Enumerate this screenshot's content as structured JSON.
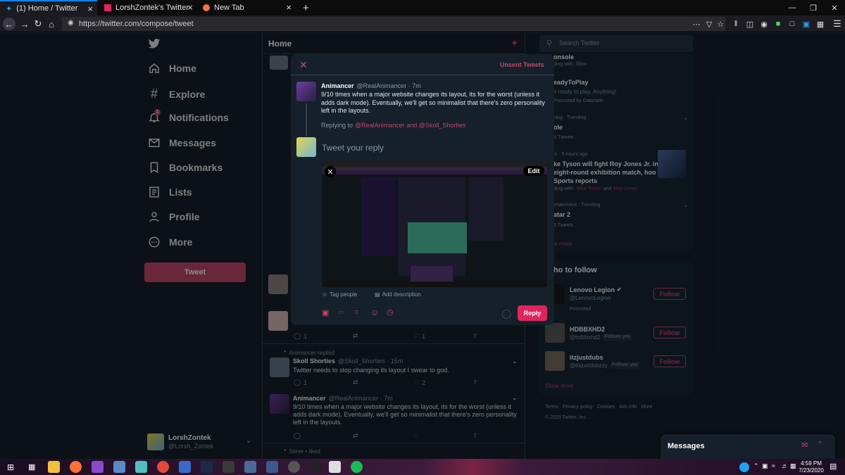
{
  "browser": {
    "tabs": [
      {
        "label": "(1) Home / Twitter"
      },
      {
        "label": "LorshZontek's Twitter Stats Sur"
      },
      {
        "label": "New Tab"
      }
    ],
    "url": "https://twitter.com/compose/tweet"
  },
  "sidebar": {
    "items": [
      {
        "label": "Home",
        "icon": "home-icon"
      },
      {
        "label": "Explore",
        "icon": "hashtag-icon"
      },
      {
        "label": "Notifications",
        "icon": "bell-icon",
        "badge": "1"
      },
      {
        "label": "Messages",
        "icon": "mail-icon"
      },
      {
        "label": "Bookmarks",
        "icon": "bookmark-icon"
      },
      {
        "label": "Lists",
        "icon": "list-icon"
      },
      {
        "label": "Profile",
        "icon": "person-icon"
      },
      {
        "label": "More",
        "icon": "more-icon"
      }
    ],
    "tweet_button": "Tweet",
    "account": {
      "name": "LorshZontek",
      "handle": "@Lorsh_Zontek"
    }
  },
  "timeline": {
    "header": "Home",
    "counts_row1": {
      "reply": "1",
      "like": "1"
    },
    "activity_label": "Animancer replied",
    "tweet1": {
      "name": "Skoll Shorties",
      "handle": "@Skoll_Shorties · 15m",
      "text": "Twitter needs to stop changing its layout I swear to god.",
      "reply": "1",
      "like": "2"
    },
    "tweet2": {
      "name": "Animancer",
      "handle": "@RealAnimancer · 7m",
      "text": "9/10 times when a major website changes its layout, its for the worst (unless it adds dark mode). Eventually, we'll get so minimalist that there's zero personality left in the layouts."
    },
    "bottom_label": "Steve • liked"
  },
  "modal": {
    "unsent": "Unsent Tweets",
    "original": {
      "name": "Animancer",
      "handle": "@RealAnimancer · 7m",
      "text": "9/10 times when a major website changes its layout, its for the worst (unless it adds dark mode). Eventually, we'll get so minimalist that there's zero personality left in the layouts."
    },
    "replying_prefix": "Replying to",
    "replying_to": "@RealAnimancer and @Skoll_Shorties",
    "placeholder": "Tweet your reply",
    "edit": "Edit",
    "tag_people": "Tag people",
    "add_description": "Add description",
    "reply_button": "Reply"
  },
  "search": {
    "placeholder": "Search Twitter"
  },
  "trends": [
    {
      "meta": "",
      "title": "onsole",
      "extra": "ding with: Xbox"
    },
    {
      "meta": "",
      "title": "eadyToPlay",
      "extra": "e ready to play. Anything!",
      "promo": "Promoted by Gatorade"
    },
    {
      "meta": "sing · Trending",
      "title": "ole",
      "extra": "K Tweets"
    },
    {
      "meta": "ts · 5 hours ago",
      "title": "ke Tyson will fight Roy Jones Jr. in eight-round exhibition match, hoo Sports reports",
      "extra_prefix": "ding with:",
      "extra_a": "Mike Tyson",
      "extra_and": "and",
      "extra_b": "Roy Jones"
    },
    {
      "meta": "ertainment · Trending",
      "title": "atar 2",
      "extra": "3 Tweets"
    }
  ],
  "show_more": "w more",
  "who_to_follow": {
    "title": "ho to follow",
    "users": [
      {
        "name": "Lenovo Legion",
        "handle": "@LenovoLegion",
        "sub": "Promoted",
        "button": "Follow"
      },
      {
        "name": "HDBBXHD2",
        "handle": "@hdbbxhd2",
        "sub": "Follows you",
        "button": "Follow"
      },
      {
        "name": "itzjustdubs",
        "handle": "@itsjustdubzzy",
        "sub": "Follows you",
        "button": "Follow"
      }
    ],
    "show_more": "Show more"
  },
  "footer": {
    "links": [
      "Terms",
      "Privacy policy",
      "Cookies",
      "Ads info",
      "More"
    ],
    "copyright": "© 2020 Twitter, Inc."
  },
  "messages_dock": {
    "label": "Messages"
  },
  "taskbar": {
    "time": "4:59 PM",
    "date": "7/23/2020"
  },
  "colors": {
    "accent": "#c2476b",
    "background": "#15202b",
    "card": "#192734",
    "pink_link": "#e0245e"
  }
}
